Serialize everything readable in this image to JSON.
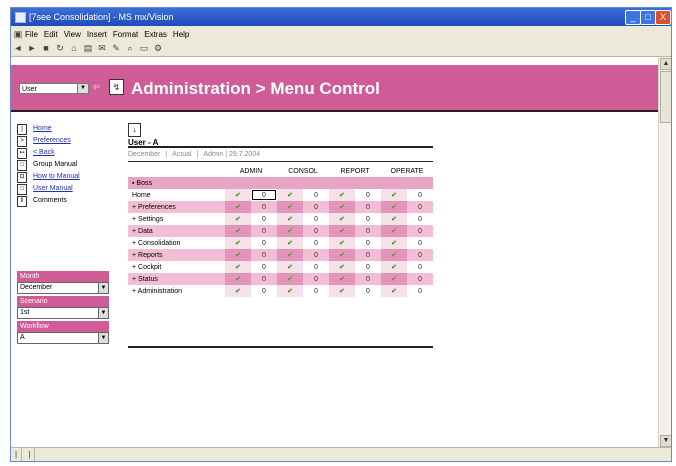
{
  "window": {
    "title": "[7see Consolidation] - MS mx/Vision",
    "menus": [
      "File",
      "Edit",
      "View",
      "Insert",
      "Format",
      "Extras",
      "Help"
    ],
    "controls": {
      "minimize": "_",
      "maximize": "□",
      "close": "X"
    }
  },
  "toolbar_icons": [
    "back-icon",
    "forward-icon",
    "stop-icon",
    "refresh-icon",
    "home-icon",
    "print-icon",
    "mail-icon",
    "edit-icon",
    "find-icon",
    "page-icon",
    "tools-icon"
  ],
  "banner": {
    "user_select": "User",
    "title": "Administration > Menu Control"
  },
  "nav": [
    {
      "label": "Home",
      "link": true
    },
    {
      "label": "Preferences",
      "link": true
    },
    {
      "label": "< Back",
      "link": true
    },
    {
      "label": "Group Manual",
      "link": false
    },
    {
      "label": "How to Manual",
      "link": true
    },
    {
      "label": "User Manual",
      "link": true
    },
    {
      "label": "Comments",
      "link": false
    }
  ],
  "filters": [
    {
      "label": "Month",
      "value": "December"
    },
    {
      "label": "Scenario",
      "value": "1st"
    },
    {
      "label": "Workflow",
      "value": "A"
    }
  ],
  "user": {
    "name": "User - A"
  },
  "meta": [
    "December",
    "Actual",
    "Admin | 29.7.2004"
  ],
  "table": {
    "headers": [
      "ADMIN",
      "CONSOL",
      "REPORT",
      "OPERATE"
    ],
    "section": "Boss",
    "rows": [
      {
        "label": "Home",
        "pink": false
      },
      {
        "label": "Preferences",
        "pink": true
      },
      {
        "label": "Settings",
        "pink": false
      },
      {
        "label": "Data",
        "pink": true
      },
      {
        "label": "Consolidation",
        "pink": false
      },
      {
        "label": "Reports",
        "pink": true
      },
      {
        "label": "Cockpit",
        "pink": false
      },
      {
        "label": "Status",
        "pink": true
      },
      {
        "label": "Administration",
        "pink": false
      }
    ],
    "check_glyph": "✔",
    "value_glyph": "0"
  }
}
